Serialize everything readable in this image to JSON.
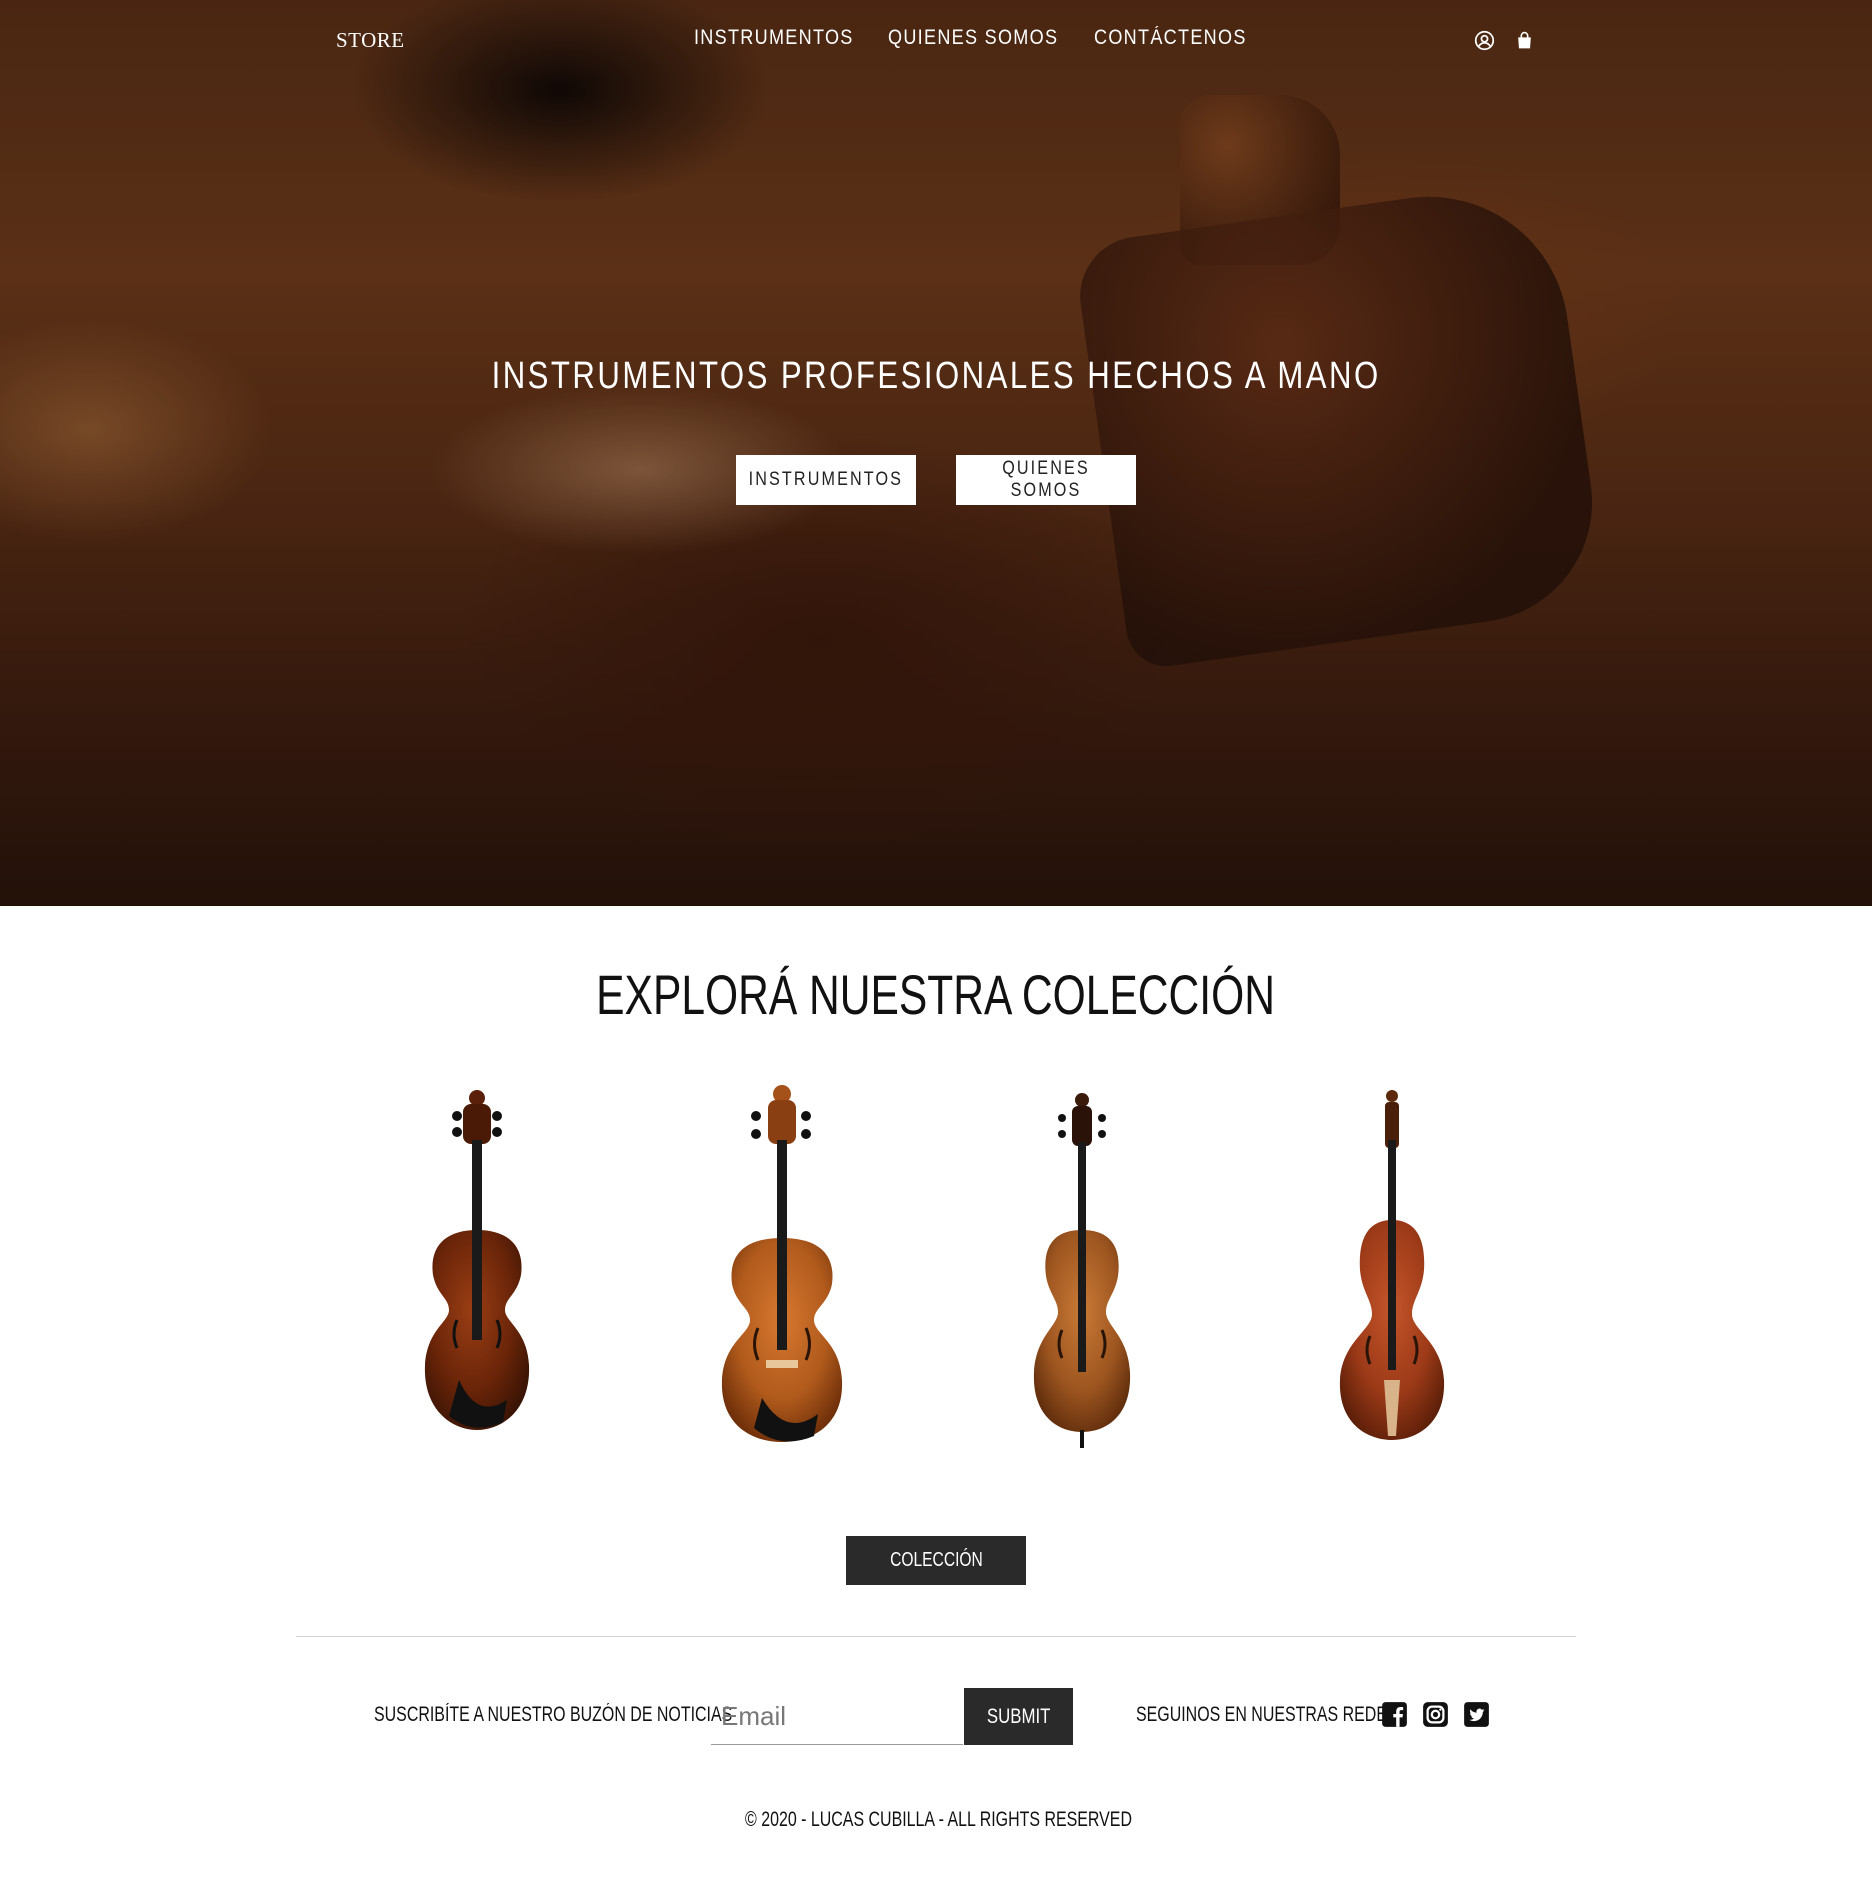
{
  "nav": {
    "brand": "STORE",
    "links": [
      "INSTRUMENTOS",
      "QUIENES SOMOS",
      "CONTÁCTENOS"
    ],
    "icons": [
      "user-circle-icon",
      "shopping-bag-icon"
    ]
  },
  "hero": {
    "title": "INSTRUMENTOS PROFESIONALES HECHOS A MANO",
    "buttons": [
      "INSTRUMENTOS",
      "QUIENES SOMOS"
    ]
  },
  "collection": {
    "title": "EXPLORÁ NUESTRA COLECCIÓN",
    "products": [
      {
        "name": "violin"
      },
      {
        "name": "viola"
      },
      {
        "name": "cello"
      },
      {
        "name": "contrabass"
      }
    ],
    "button_label": "COLECCIÓN"
  },
  "footer": {
    "newsletter_label": "SUSCRIBÍTE A NUESTRO BUZÓN DE NOTICIAS",
    "email_placeholder": "Email",
    "submit_label": "SUBMIT",
    "social_label": "SEGUINOS EN NUESTRAS REDES",
    "social_icons": [
      "facebook-icon",
      "instagram-icon",
      "twitter-icon"
    ],
    "copyright": "© 2020 - LUCAS CUBILLA - ALL RIGHTS RESERVED"
  },
  "colors": {
    "hero_base": "#5a2f17",
    "dark_button": "#2a2a2a",
    "text": "#111111",
    "divider": "#d2d2d2"
  }
}
